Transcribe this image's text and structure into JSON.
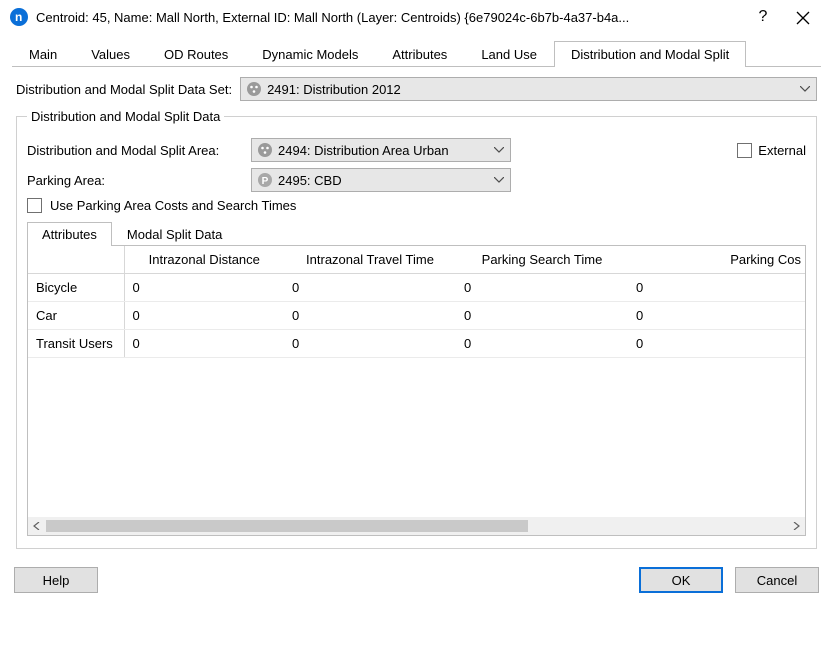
{
  "window": {
    "title": "Centroid: 45, Name: Mall North, External ID: Mall North (Layer: Centroids) {6e79024c-6b7b-4a37-b4a..."
  },
  "tabs": {
    "main": "Main",
    "values": "Values",
    "odroutes": "OD Routes",
    "dynamic": "Dynamic Models",
    "attributes": "Attributes",
    "landuse": "Land Use",
    "dms": "Distribution and Modal Split"
  },
  "ds_label": "Distribution and Modal Split Data Set:",
  "ds_value": "2491: Distribution 2012",
  "group_legend": "Distribution and Modal Split Data",
  "area_label": "Distribution and Modal Split Area:",
  "area_value": "2494: Distribution Area Urban",
  "external_label": "External",
  "parking_label": "Parking Area:",
  "parking_value": "2495: CBD",
  "useparking_label": "Use Parking Area Costs and Search Times",
  "subtabs": {
    "attributes": "Attributes",
    "msd": "Modal Split Data"
  },
  "table": {
    "headers": {
      "row": "",
      "c1": "Intrazonal Distance",
      "c2": "Intrazonal Travel Time",
      "c3": "Parking Search Time",
      "c4": "Parking Cos"
    },
    "rows": [
      {
        "name": "Bicycle",
        "c1": "0",
        "c2": "0",
        "c3": "0",
        "c4": "0"
      },
      {
        "name": "Car",
        "c1": "0",
        "c2": "0",
        "c3": "0",
        "c4": "0"
      },
      {
        "name": "Transit Users",
        "c1": "0",
        "c2": "0",
        "c3": "0",
        "c4": "0"
      }
    ]
  },
  "footer": {
    "help": "Help",
    "ok": "OK",
    "cancel": "Cancel"
  }
}
